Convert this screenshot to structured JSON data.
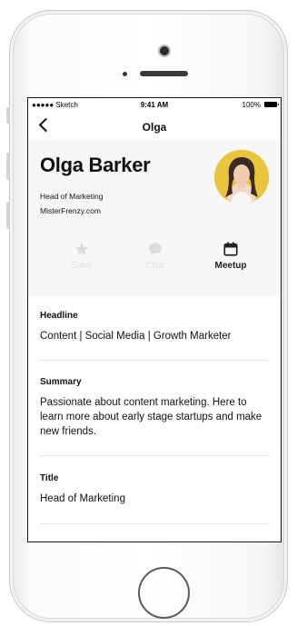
{
  "status_bar": {
    "carrier": "●●●●● Sketch",
    "time": "9:41 AM",
    "battery": "100%"
  },
  "nav": {
    "title": "Olga",
    "back_icon": "chevron-left-icon"
  },
  "profile": {
    "name": "Olga Barker",
    "role": "Head of Marketing",
    "website": "MisterFrenzy.com"
  },
  "actions": [
    {
      "label": "Save",
      "icon": "star-icon",
      "active": false
    },
    {
      "label": "Chat",
      "icon": "chat-bubble-icon",
      "active": false
    },
    {
      "label": "Meetup",
      "icon": "calendar-icon",
      "active": true
    }
  ],
  "sections": {
    "headline": {
      "title": "Headline",
      "body": "Content | Social Media | Growth Marketer"
    },
    "summary": {
      "title": "Summary",
      "body": "Passionate about content marketing. Here to learn more about early stage startups and make new friends."
    },
    "title": {
      "title": "Title",
      "body": "Head of Marketing"
    }
  },
  "colors": {
    "avatar_bg": "#e8c53a",
    "profile_bg": "#f7f7f7",
    "inactive_action": "#dcdcdc",
    "active_action": "#222222"
  }
}
